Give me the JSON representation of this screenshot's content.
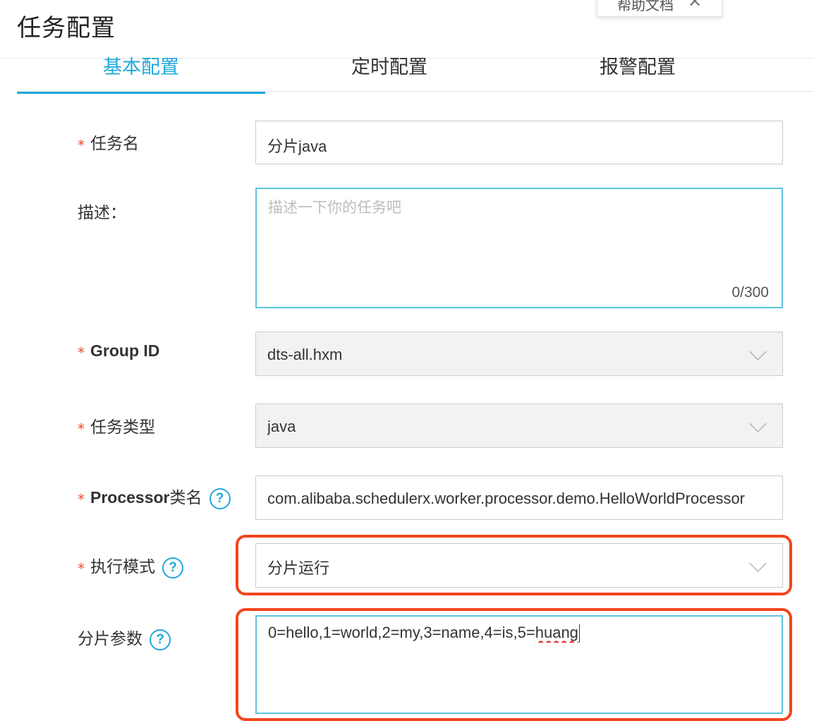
{
  "page": {
    "title": "任务配置"
  },
  "help_popup": {
    "label": "帮助文档"
  },
  "tabs": [
    {
      "label": "基本配置",
      "active": true
    },
    {
      "label": "定时配置",
      "active": false
    },
    {
      "label": "报警配置",
      "active": false
    }
  ],
  "form": {
    "required_mark": "*",
    "task_name": {
      "label": "任务名",
      "value": "分片java"
    },
    "description": {
      "label": "描述：",
      "placeholder": "描述一下你的任务吧",
      "counter": "0/300"
    },
    "group_id": {
      "label": "Group ID",
      "value": "dts-all.hxm"
    },
    "task_type": {
      "label": "任务类型",
      "value": "java"
    },
    "processor": {
      "label_latin": "Processor",
      "label_cn": "类名",
      "value": "com.alibaba.schedulerx.worker.processor.demo.HelloWorldProcessor"
    },
    "exec_mode": {
      "label": "执行模式",
      "value": "分片运行"
    },
    "shard_params": {
      "label": "分片参数",
      "value_main": "0=hello,1=world,2=my,3=name,4=is,5=",
      "value_flagged": "huang"
    }
  },
  "icons": {
    "help": "question-circle-icon",
    "close": "close-icon",
    "dropdown": "chevron-down-icon"
  },
  "colors": {
    "accent": "#1fa8db",
    "required": "#f04e23",
    "highlight_box": "#f2451d"
  }
}
